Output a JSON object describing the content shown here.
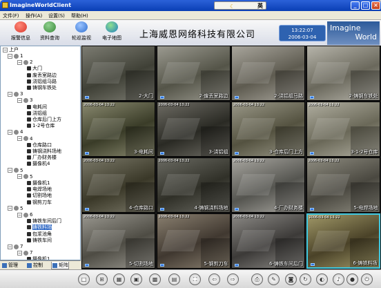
{
  "window": {
    "title": "ImagineWorldClient",
    "ime": "英",
    "min": "_",
    "max": "□",
    "close": "×"
  },
  "menu": [
    {
      "label": "文件(F)"
    },
    {
      "label": "操作(A)"
    },
    {
      "label": "设置(S)"
    },
    {
      "label": "帮助(H)"
    }
  ],
  "header": {
    "buttons": [
      {
        "label": "报警信息",
        "icon": "alarm-heart-icon",
        "color": "#d9362b"
      },
      {
        "label": "资料查询",
        "icon": "user-search-icon",
        "color": "#3a8a3a"
      },
      {
        "label": "轮巡监视",
        "icon": "refresh-cycle-icon",
        "color": "#2f6fd0"
      },
      {
        "label": "电子地图",
        "icon": "globe-map-icon",
        "color": "#1f7fc0"
      }
    ],
    "company": "上海威恩网络科技有限公司",
    "time": "13:22:07",
    "date": "2006-03-04",
    "logo_line1": "Imagine",
    "logo_line2": "World"
  },
  "tree": {
    "root": "上户",
    "nodes": [
      {
        "type": "group",
        "label": "1",
        "depth": 1
      },
      {
        "type": "group",
        "label": "2",
        "depth": 2
      },
      {
        "type": "cam",
        "label": "大门",
        "depth": 3
      },
      {
        "type": "cam",
        "label": "废丢室路边",
        "depth": 3
      },
      {
        "type": "cam",
        "label": "浇铝组马路",
        "depth": 3
      },
      {
        "type": "cam",
        "label": "铸钢车铁处",
        "depth": 3
      },
      {
        "type": "group",
        "label": "3",
        "depth": 1
      },
      {
        "type": "group",
        "label": "3",
        "depth": 2
      },
      {
        "type": "cam",
        "label": "电耗间",
        "depth": 3
      },
      {
        "type": "cam",
        "label": "浇铝组",
        "depth": 3
      },
      {
        "type": "cam",
        "label": "仓库后门上方",
        "depth": 3
      },
      {
        "type": "cam",
        "label": "1-2号仓库",
        "depth": 3
      },
      {
        "type": "group",
        "label": "4",
        "depth": 1
      },
      {
        "type": "group",
        "label": "4",
        "depth": 2
      },
      {
        "type": "cam",
        "label": "仓库路口",
        "depth": 3
      },
      {
        "type": "cam",
        "label": "铸钢浇料场地",
        "depth": 3
      },
      {
        "type": "cam",
        "label": "厂办财务楼",
        "depth": 3
      },
      {
        "type": "cam",
        "label": "摄像机4",
        "depth": 3
      },
      {
        "type": "group",
        "label": "5",
        "depth": 1
      },
      {
        "type": "group",
        "label": "5",
        "depth": 2
      },
      {
        "type": "cam",
        "label": "摄像机1",
        "depth": 3
      },
      {
        "type": "cam",
        "label": "电焊场地",
        "depth": 3
      },
      {
        "type": "cam",
        "label": "切割场地",
        "depth": 3
      },
      {
        "type": "cam",
        "label": "钢剪刀车",
        "depth": 3
      },
      {
        "type": "group",
        "label": "5",
        "depth": 1
      },
      {
        "type": "group",
        "label": "6",
        "depth": 2
      },
      {
        "type": "cam",
        "label": "铸铁车间后门",
        "depth": 3
      },
      {
        "type": "cam",
        "label": "铸铁料场",
        "depth": 3,
        "selected": true
      },
      {
        "type": "cam",
        "label": "包浆池角",
        "depth": 3
      },
      {
        "type": "cam",
        "label": "铸铁车间",
        "depth": 3
      },
      {
        "type": "group",
        "label": "7",
        "depth": 1
      },
      {
        "type": "group",
        "label": "7",
        "depth": 2
      },
      {
        "type": "cam",
        "label": "摄像机1",
        "depth": 3
      }
    ]
  },
  "side_tabs": [
    {
      "label": "管理"
    },
    {
      "label": "控制"
    },
    {
      "label": "矩阵"
    }
  ],
  "cells": [
    {
      "label": "2-大门",
      "ts": "",
      "c1": "#7c7c72",
      "c2": "#3f4036"
    },
    {
      "label": "2-废丢室路边",
      "ts": "",
      "c1": "#9b9a90",
      "c2": "#545448"
    },
    {
      "label": "2-浇铝组马路",
      "ts": "",
      "c1": "#a8a59c",
      "c2": "#5e5b50"
    },
    {
      "label": "2-铸钢车铁处",
      "ts": "",
      "c1": "#b6b4aa",
      "c2": "#6a685c"
    },
    {
      "label": "3-电耗间",
      "ts": "2006-03-04 13:22",
      "c1": "#8a8a70",
      "c2": "#3a3c28"
    },
    {
      "label": "3-浇铝组",
      "ts": "2006-03-04 13:22",
      "c1": "#6e6c64",
      "c2": "#2a2a24"
    },
    {
      "label": "3-仓库后门上方",
      "ts": "2006-03-04 13:22",
      "c1": "#9a9888",
      "c2": "#545240"
    },
    {
      "label": "3-1-2号仓库",
      "ts": "2006-03-04 13:22",
      "c1": "#b0aea0",
      "c2": "#6a6858"
    },
    {
      "label": "4-仓库路口",
      "ts": "2006-03-04 13:22",
      "c1": "#7a7868",
      "c2": "#3a3828"
    },
    {
      "label": "4-铸钢浇料场地",
      "ts": "2006-03-04 13:22",
      "c1": "#6a6a62",
      "c2": "#303028"
    },
    {
      "label": "4-厂办财务楼",
      "ts": "2006-03-04 13:22",
      "c1": "#a8a6a0",
      "c2": "#555550"
    },
    {
      "label": "5-电焊场地",
      "ts": "2006-03-04 13:22",
      "c1": "#8e8c80",
      "c2": "#4a4840"
    },
    {
      "label": "5-切割场地",
      "ts": "2006-03-04 13:22",
      "c1": "#9a9890",
      "c2": "#4e4c44"
    },
    {
      "label": "5-钢剪刀车",
      "ts": "2006-03-04 13:22",
      "c1": "#8a8070",
      "c2": "#403830"
    },
    {
      "label": "6-铸铁车间后门",
      "ts": "2006-03-04 13:22",
      "c1": "#8c8a86",
      "c2": "#3c3a38"
    },
    {
      "label": "6-铸铁料场",
      "ts": "2006-03-04 13:22",
      "c1": "#a09868",
      "c2": "#4a4228"
    }
  ],
  "toolbar": [
    {
      "icon": "layout-1x1-icon",
      "glyph": "□"
    },
    {
      "icon": "layout-2x2-icon",
      "glyph": "⊞"
    },
    {
      "icon": "layout-3x3-icon",
      "glyph": "▦"
    },
    {
      "icon": "layout-1plus5-icon",
      "glyph": "▣"
    },
    {
      "icon": "layout-4x4-icon",
      "glyph": "▩"
    },
    {
      "icon": "layout-grid-icon",
      "glyph": "▤"
    },
    {
      "icon": "fullscreen-icon",
      "glyph": "⛶"
    },
    {
      "icon": "prev-page-icon",
      "glyph": "⇦"
    },
    {
      "icon": "next-page-icon",
      "glyph": "⇨"
    },
    {
      "icon": "record-icon",
      "glyph": "⎙"
    },
    {
      "icon": "wrench-icon",
      "glyph": "✎"
    },
    {
      "icon": "snapshot-camera-icon",
      "glyph": "◙"
    },
    {
      "icon": "playback-icon",
      "glyph": "↻"
    },
    {
      "icon": "ptz-control-icon",
      "glyph": "◐"
    },
    {
      "icon": "volume-icon",
      "glyph": "♪"
    },
    {
      "icon": "alarm-icon",
      "glyph": "●"
    },
    {
      "icon": "exit-icon",
      "glyph": "⏻"
    }
  ]
}
